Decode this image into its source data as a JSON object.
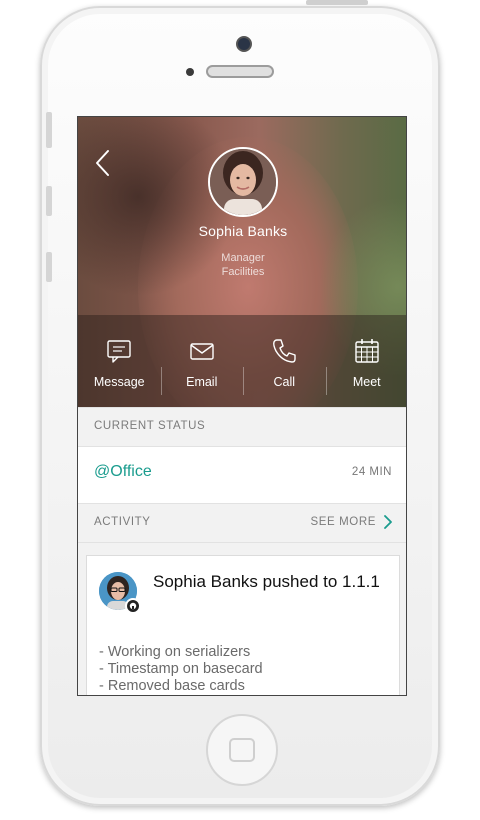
{
  "contact": {
    "name": "Sophia Banks",
    "role_line1": "Manager",
    "role_line2": "Facilities"
  },
  "actions": [
    {
      "label": "Message",
      "icon": "message-icon"
    },
    {
      "label": "Email",
      "icon": "email-icon"
    },
    {
      "label": "Call",
      "icon": "phone-icon"
    },
    {
      "label": "Meet",
      "icon": "calendar-icon"
    }
  ],
  "current_status": {
    "heading": "CURRENT STATUS",
    "value": "@Office",
    "elapsed": "24 MIN"
  },
  "activity": {
    "heading": "ACTIVITY",
    "see_more": "SEE MORE",
    "card": {
      "title": "Sophia Banks pushed to 1.1.1",
      "lines": [
        "- Working on serializers",
        "- Timestamp on basecard",
        "- Removed base cards"
      ]
    }
  },
  "colors": {
    "accent": "#1a9c8e",
    "hero_overlay": "#281c18"
  }
}
